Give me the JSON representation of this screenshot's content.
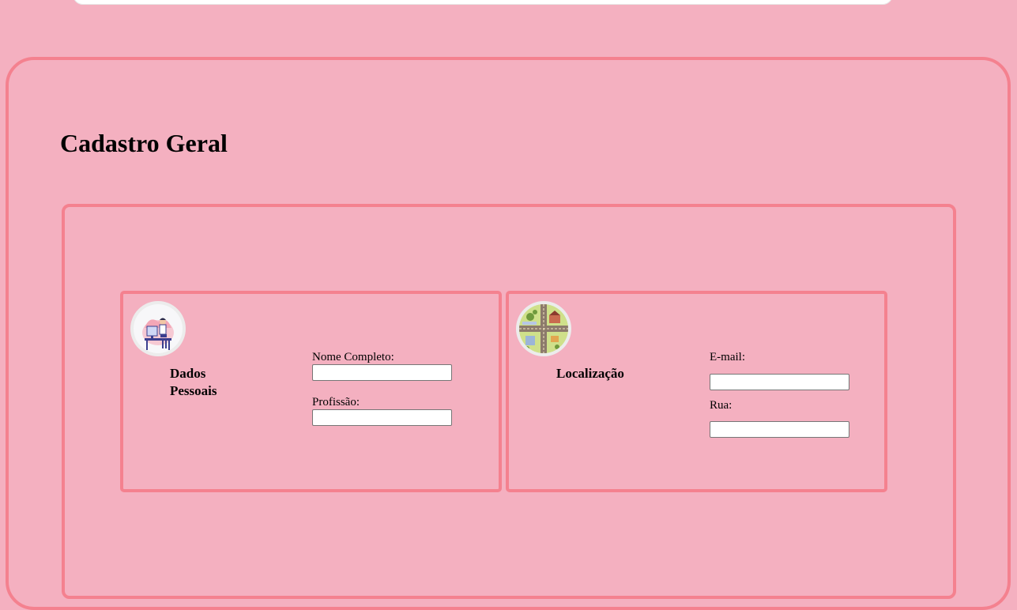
{
  "page": {
    "title": "Cadastro Geral"
  },
  "sections": {
    "personal": {
      "title": "Dados Pessoais",
      "icon": "person-at-desk-icon",
      "fields": [
        {
          "label": "Nome Completo:",
          "value": "",
          "placeholder": ""
        },
        {
          "label": "Profissão:",
          "value": "",
          "placeholder": ""
        }
      ]
    },
    "location": {
      "title": "Localização",
      "icon": "city-map-icon",
      "fields": [
        {
          "label": "E-mail:",
          "value": "",
          "placeholder": ""
        },
        {
          "label": "Rua:",
          "value": "",
          "placeholder": ""
        }
      ]
    }
  },
  "colors": {
    "background": "#f4b0c0",
    "border": "#f4818f"
  }
}
